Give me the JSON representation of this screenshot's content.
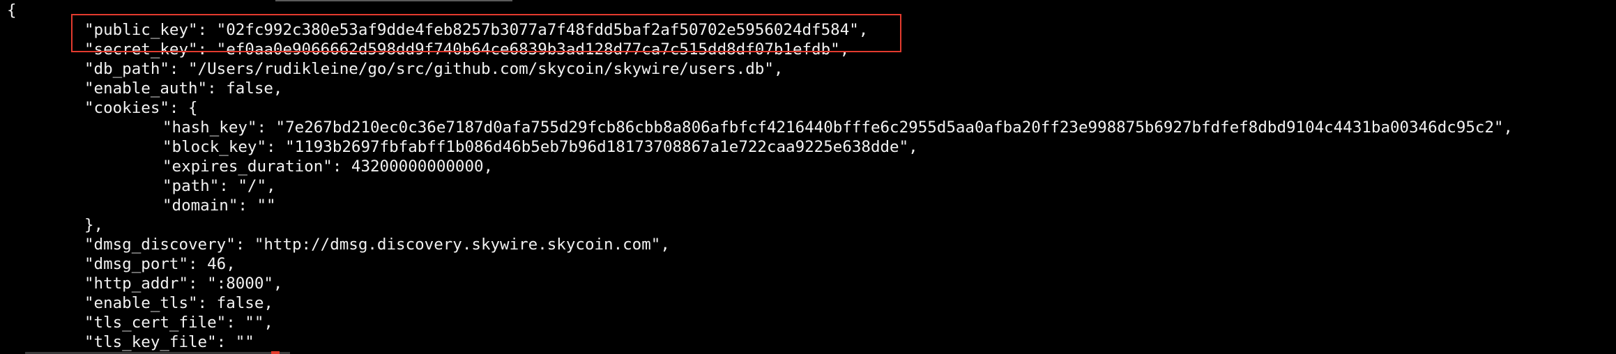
{
  "window": {
    "accent_color": "#e33b2e",
    "background_color": "#000000",
    "text_color": "#f2f2f2"
  },
  "lines": [
    "{",
    "\"public_key\": \"02fc992c380e53af9dde4feb8257b3077a7f48fdd5baf2af50702e5956024df584\",",
    "\"secret_key\": \"ef0aa0e9066662d598dd9f740b64ce6839b3ad128d77ca7c515dd8df07b1efdb\",",
    "\"db_path\": \"/Users/rudikleine/go/src/github.com/skycoin/skywire/users.db\",",
    "\"enable_auth\": false,",
    "\"cookies\": {",
    "\"hash_key\": \"7e267bd210ec0c36e7187d0afa755d29fcb86cbb8a806afbfcf4216440bfffe6c2955d5aa0afba20ff23e998875b6927bfdfef8dbd9104c4431ba00346dc95c2\",",
    "\"block_key\": \"1193b2697fbfabff1b086d46b5eb7b96d18173708867a1e722caa9225e638dde\",",
    "\"expires_duration\": 43200000000000,",
    "\"path\": \"/\",",
    "\"domain\": \"\"",
    "},",
    "\"dmsg_discovery\": \"http://dmsg.discovery.skywire.skycoin.com\",",
    "\"dmsg_port\": 46,",
    "\"http_addr\": \":8000\",",
    "\"enable_tls\": false,",
    "\"tls_cert_file\": \"\",",
    "\"tls_key_file\": \"\""
  ]
}
